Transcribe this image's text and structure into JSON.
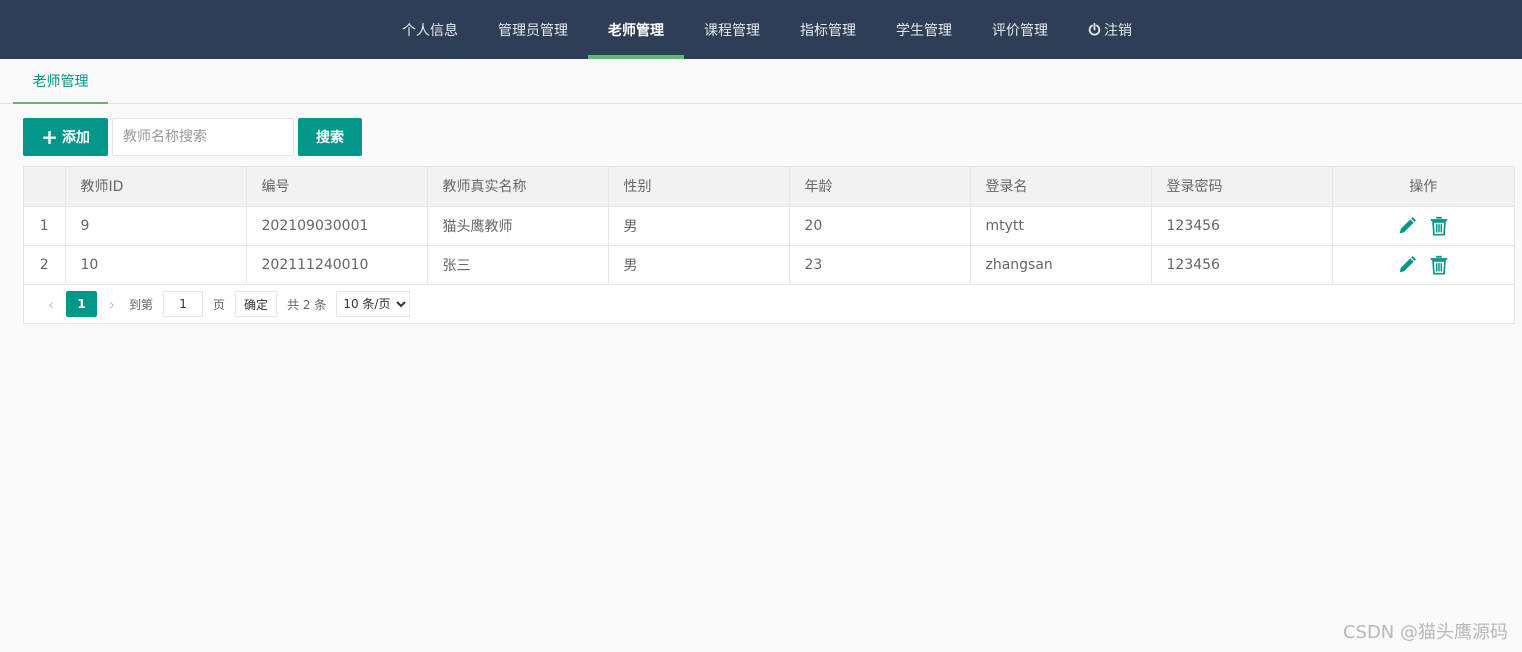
{
  "nav": {
    "items": [
      {
        "label": "个人信息"
      },
      {
        "label": "管理员管理"
      },
      {
        "label": "老师管理"
      },
      {
        "label": "课程管理"
      },
      {
        "label": "指标管理"
      },
      {
        "label": "学生管理"
      },
      {
        "label": "评价管理"
      },
      {
        "label": "注销",
        "icon": "power-icon"
      }
    ],
    "active_index": 2,
    "active_color": "#5fb878",
    "bg_color": "#2f3e57"
  },
  "tab": {
    "label": "老师管理"
  },
  "toolbar": {
    "add_label": "添加",
    "search_placeholder": "教师名称搜索",
    "search_value": "",
    "search_label": "搜索",
    "accent_color": "#009688"
  },
  "table": {
    "columns": [
      "",
      "教师ID",
      "编号",
      "教师真实名称",
      "性别",
      "年龄",
      "登录名",
      "登录密码",
      "操作"
    ],
    "rows": [
      [
        "1",
        "9",
        "202109030001",
        "猫头鹰教师",
        "男",
        "20",
        "mtytt",
        "123456"
      ],
      [
        "2",
        "10",
        "202111240010",
        "张三",
        "男",
        "23",
        "zhangsan",
        "123456"
      ]
    ],
    "row_actions": [
      "edit-icon",
      "delete-icon"
    ]
  },
  "pager": {
    "current_page": "1",
    "goto_label": "到第",
    "goto_value": "1",
    "page_unit": "页",
    "confirm_label": "确定",
    "total_label": "共 2 条",
    "page_size_label": "10 条/页"
  },
  "watermark": "CSDN @猫头鹰源码"
}
